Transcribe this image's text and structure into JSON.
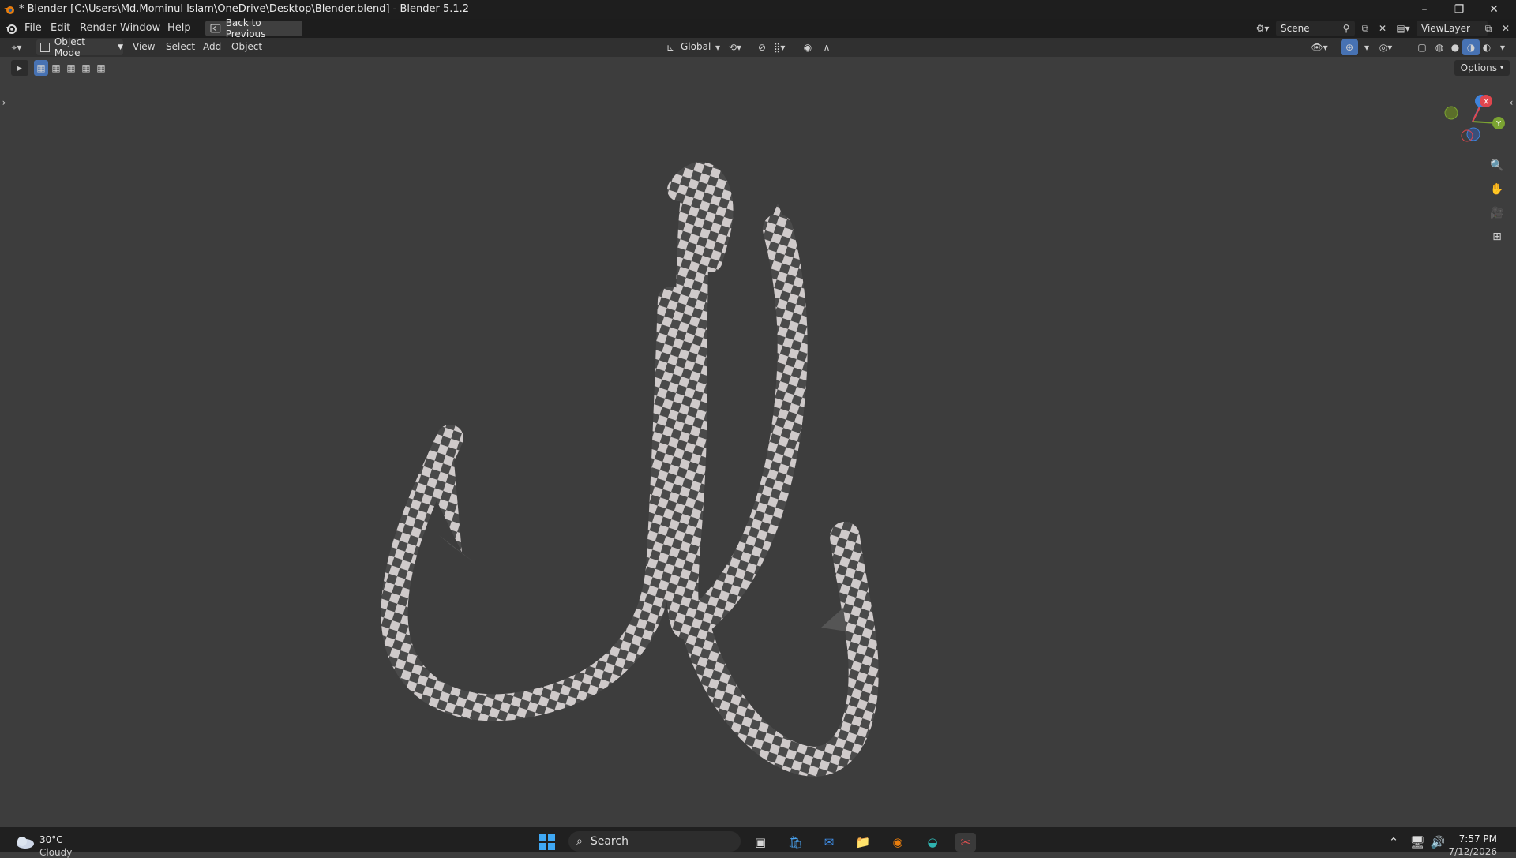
{
  "window": {
    "title": "* Blender [C:\\Users\\Md.Mominul Islam\\OneDrive\\Desktop\\Blender.blend] - Blender 5.1.2",
    "minimize_glyph": "–",
    "maximize_glyph": "❐",
    "close_glyph": "✕"
  },
  "topbar": {
    "menus": [
      "File",
      "Edit",
      "Render",
      "Window",
      "Help"
    ],
    "back_button": "Back to Previous",
    "scene": "Scene",
    "view_layer": "ViewLayer"
  },
  "header": {
    "mode": "Object Mode",
    "menus": [
      "View",
      "Select",
      "Add",
      "Object"
    ],
    "orientation": "Global"
  },
  "tools": {
    "options": "Options"
  },
  "gizmo": {
    "x_label": "X",
    "y_label": "Y",
    "x_color": "#e0464e",
    "y_color": "#7ba332",
    "z_color": "#3f83db"
  },
  "taskbar": {
    "weather_temp": "30°C",
    "weather_desc": "Cloudy",
    "search_placeholder": "Search",
    "time": "7:57 PM",
    "date": "7/12/2026"
  }
}
